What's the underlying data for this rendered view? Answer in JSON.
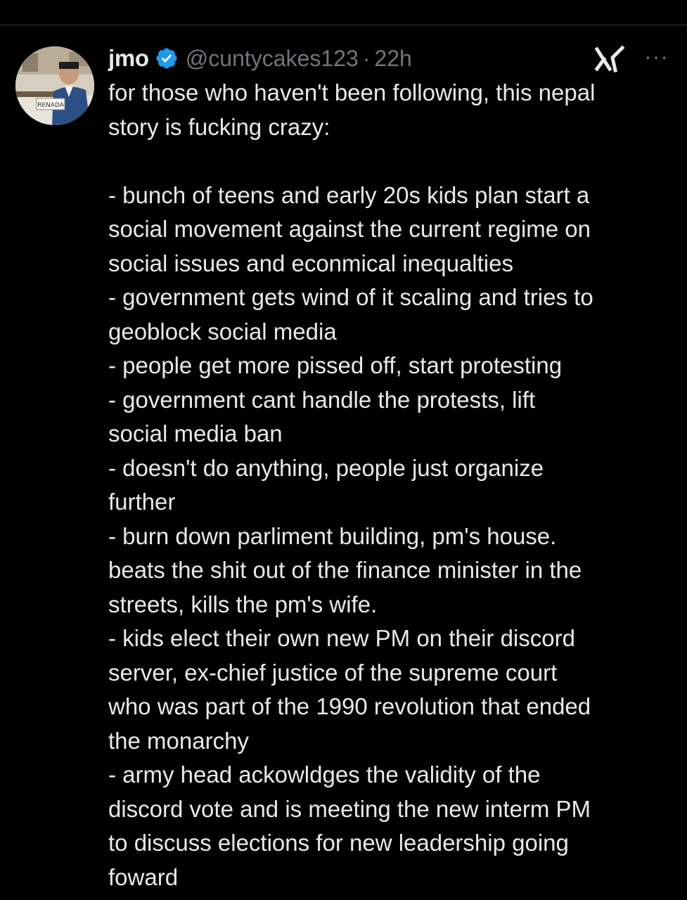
{
  "post": {
    "display_name": "jmo",
    "handle": "@cuntycakes123",
    "separator": "·",
    "time": "22h",
    "more_label": "···",
    "verified": true,
    "icons": {
      "verified": "verified-badge-icon",
      "grok": "grok-icon",
      "more": "more-options-icon"
    },
    "avatar_sign_text": "RENADA",
    "body_lines": [
      "for those who haven't been following, this nepal",
      "story is fucking crazy:",
      "",
      "- bunch of teens and early 20s kids plan start a",
      "social movement against the current regime on",
      "social issues and econmical inequalties",
      "- government gets wind of it scaling and tries to",
      "geoblock social media",
      "- people get more pissed off, start protesting",
      "- government cant handle the protests, lift",
      "social media ban",
      "- doesn't do anything, people just organize",
      "further",
      "- burn down parliment building, pm's house.",
      "beats the shit out of the finance minister in the",
      "streets, kills the pm's wife.",
      "- kids elect their own new PM on their discord",
      "server, ex-chief justice of the supreme court",
      "who was part of the 1990 revolution that ended",
      "the monarchy",
      "- army head ackowldges the validity of the",
      "discord vote and is meeting the new interm PM",
      "to discuss elections for new leadership going",
      "foward"
    ]
  },
  "colors": {
    "background": "#000000",
    "text_primary": "#e7e9ea",
    "text_secondary": "#71767b",
    "verified_blue": "#1d9bf0",
    "divider": "#2f3336"
  }
}
